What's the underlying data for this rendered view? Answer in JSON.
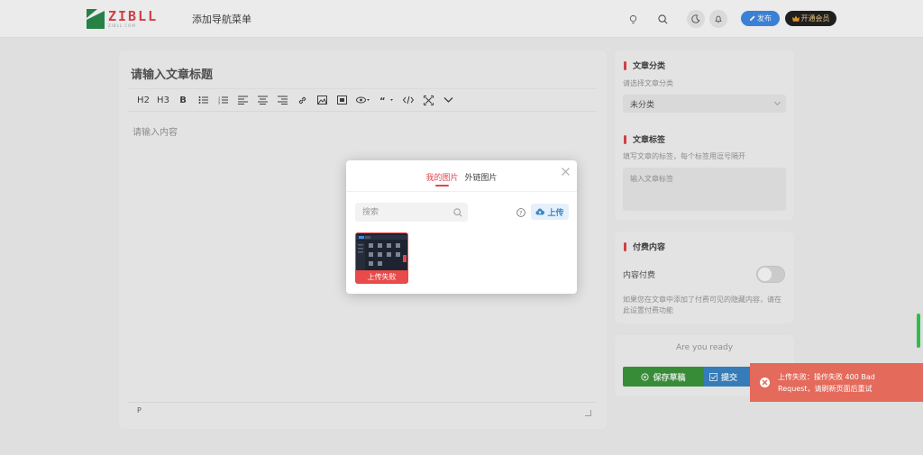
{
  "header": {
    "logo_text": "ZIBLL",
    "logo_sub": "ZIBLL.COM",
    "nav_title": "添加导航菜单",
    "publish_label": "发布",
    "vip_label": "开通会员"
  },
  "editor": {
    "title_placeholder": "请输入文章标题",
    "toolbar": [
      "H2",
      "H3",
      "B"
    ],
    "content_placeholder": "请输入内容",
    "status_path": "P"
  },
  "sidebar": {
    "category": {
      "title": "文章分类",
      "hint": "请选择文章分类",
      "selected": "未分类"
    },
    "tags": {
      "title": "文章标签",
      "hint": "填写文章的标签，每个标签用逗号隔开",
      "placeholder": "输入文章标签"
    },
    "paid": {
      "title": "付费内容",
      "label": "内容付费",
      "hint": "如果您在文章中添加了付费可见的隐藏内容，请在此设置付费功能"
    },
    "actions": {
      "ready": "Are you ready",
      "save_draft": "保存草稿",
      "submit": "提交"
    }
  },
  "modal": {
    "tabs": [
      "我的图片",
      "外链图片"
    ],
    "active_tab": 0,
    "search_placeholder": "搜索",
    "upload_label": "上传",
    "thumb_status": "上传失败"
  },
  "toast": {
    "message": "上传失败：操作失败 400 Bad Request，请刷新页面后重试"
  },
  "colors": {
    "accent": "#e0464c",
    "primary": "#3a87c8",
    "success": "#3c9a3c",
    "toast_bg": "#e46a5b",
    "vip_bg": "#222222"
  }
}
